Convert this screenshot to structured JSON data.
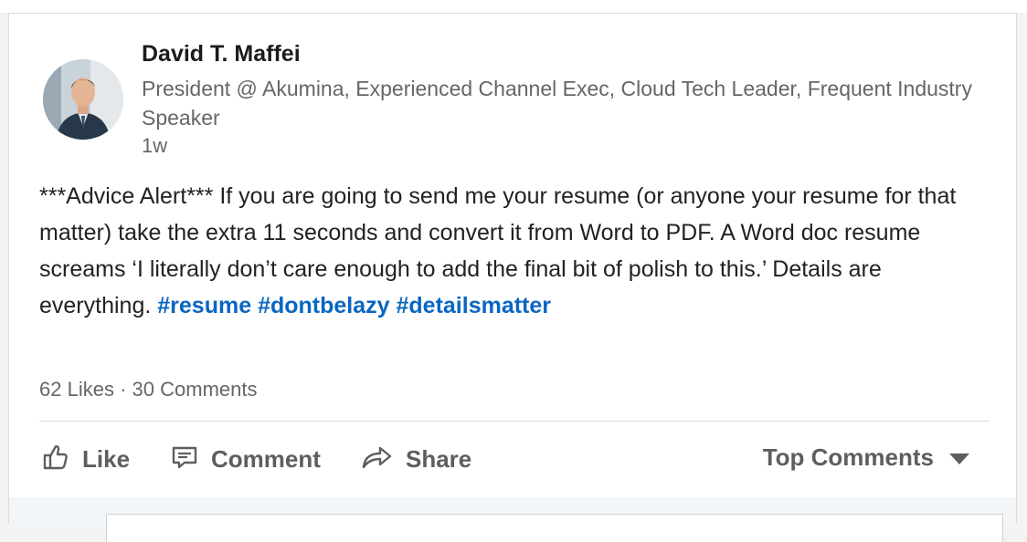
{
  "post": {
    "author": {
      "name": "David T. Maffei",
      "headline": "President @ Akumina, Experienced Channel Exec, Cloud Tech Leader, Frequent Industry Speaker",
      "time": "1w"
    },
    "body_text": "***Advice Alert***  If you are going to send me your resume (or anyone your resume for that matter) take the extra 11 seconds and convert it from Word to PDF. A Word doc resume screams ‘I literally don’t care enough to add the final bit of polish to this.’  Details are everything. ",
    "hashtags": [
      "#resume",
      "#dontbelazy",
      "#detailsmatter"
    ],
    "likes": "62 Likes",
    "separator": "·",
    "comments": "30 Comments"
  },
  "actions": {
    "like_label": "Like",
    "comment_label": "Comment",
    "share_label": "Share",
    "sort_label": "Top Comments"
  },
  "colors": {
    "hashtag": "#0a66c2",
    "muted_text": "#666666",
    "action_text": "#5e5e5e"
  }
}
